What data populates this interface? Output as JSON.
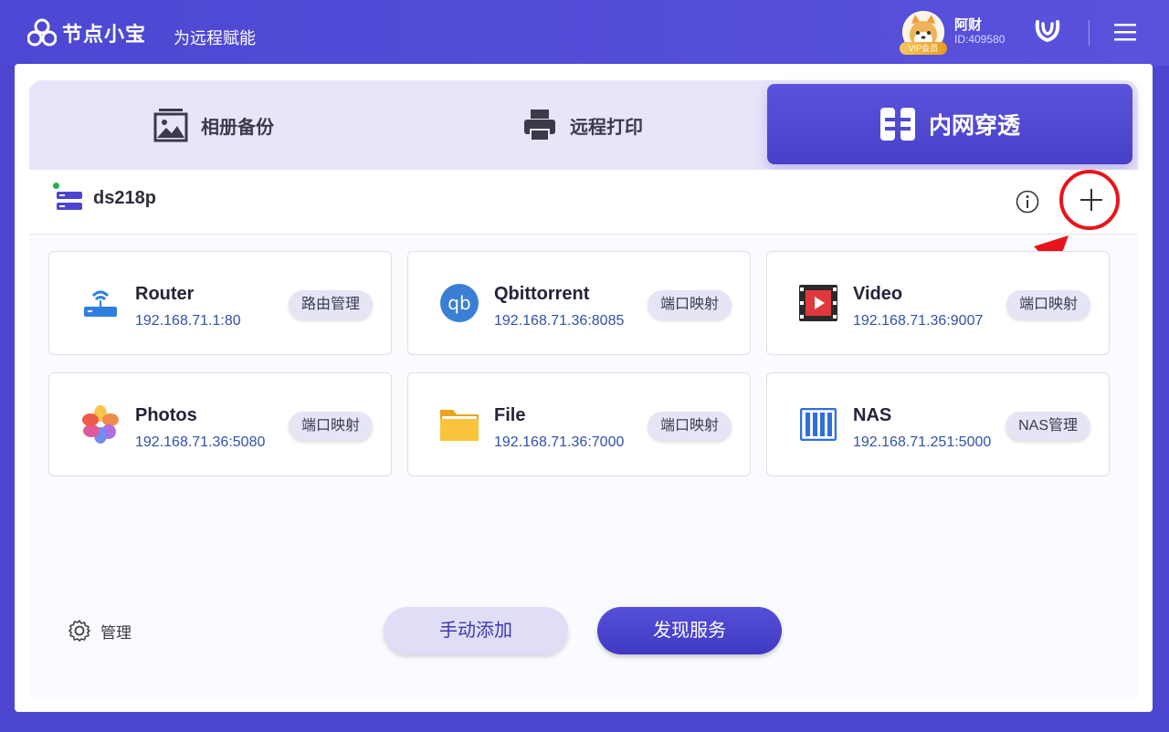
{
  "header": {
    "app_name": "节点小宝",
    "slogan": "为远程赋能",
    "user": {
      "name": "阿财",
      "id": "ID:409580",
      "vip_label": "VIP会员"
    }
  },
  "tabs": [
    {
      "label": "相册备份",
      "icon": "photo-album-icon"
    },
    {
      "label": "远程打印",
      "icon": "printer-icon"
    },
    {
      "label": "内网穿透",
      "icon": "tunnel-icon",
      "active": true
    }
  ],
  "device": {
    "name": "ds218p",
    "status": "online"
  },
  "services": [
    {
      "name": "Router",
      "address": "192.168.71.1:80",
      "action": "路由管理",
      "icon": "router-icon"
    },
    {
      "name": "Qbittorrent",
      "address": "192.168.71.36:8085",
      "action": "端口映射",
      "icon": "qbittorrent-icon"
    },
    {
      "name": "Video",
      "address": "192.168.71.36:9007",
      "action": "端口映射",
      "icon": "video-icon"
    },
    {
      "name": "Photos",
      "address": "192.168.71.36:5080",
      "action": "端口映射",
      "icon": "photos-icon"
    },
    {
      "name": "File",
      "address": "192.168.71.36:7000",
      "action": "端口映射",
      "icon": "folder-icon"
    },
    {
      "name": "NAS",
      "address": "192.168.71.251:5000",
      "action": "NAS管理",
      "icon": "nas-icon"
    }
  ],
  "footer": {
    "manage_label": "管理",
    "manual_add_label": "手动添加",
    "discover_label": "发现服务"
  },
  "colors": {
    "accent": "#4b45cf",
    "highlight": "#e8141c"
  }
}
